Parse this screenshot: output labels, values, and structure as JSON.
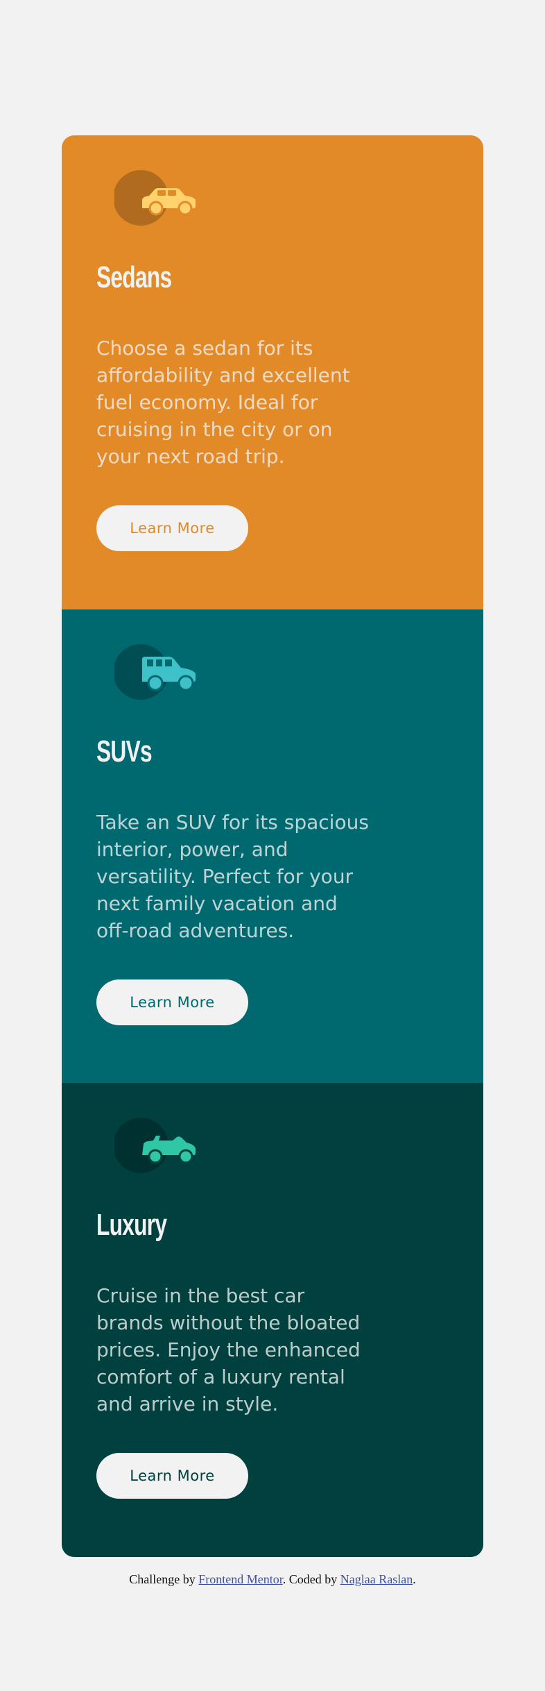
{
  "colors": {
    "background": "#f2f2f2",
    "sedans": "#e28a27",
    "suvs": "#006970",
    "luxury": "#004140"
  },
  "cards": [
    {
      "icon": "sedan-car-icon",
      "title": "Sedans",
      "text": "Choose a sedan for its affordability and excellent fuel economy. Ideal for cruising in the city or on your next road trip.",
      "button": "Learn More"
    },
    {
      "icon": "suv-car-icon",
      "title": "SUVs",
      "text": "Take an SUV for its spacious interior, power, and versatility. Perfect for your next family vacation and off-road adventures.",
      "button": "Learn More"
    },
    {
      "icon": "luxury-car-icon",
      "title": "Luxury",
      "text": "Cruise in the best car brands without the bloated prices. Enjoy the enhanced comfort of a luxury rental and arrive in style.",
      "button": "Learn More"
    }
  ],
  "attribution": {
    "prefix": "Challenge by ",
    "link1": "Frontend Mentor",
    "middle": ". Coded by ",
    "link2": "Naglaa Raslan",
    "suffix": "."
  }
}
